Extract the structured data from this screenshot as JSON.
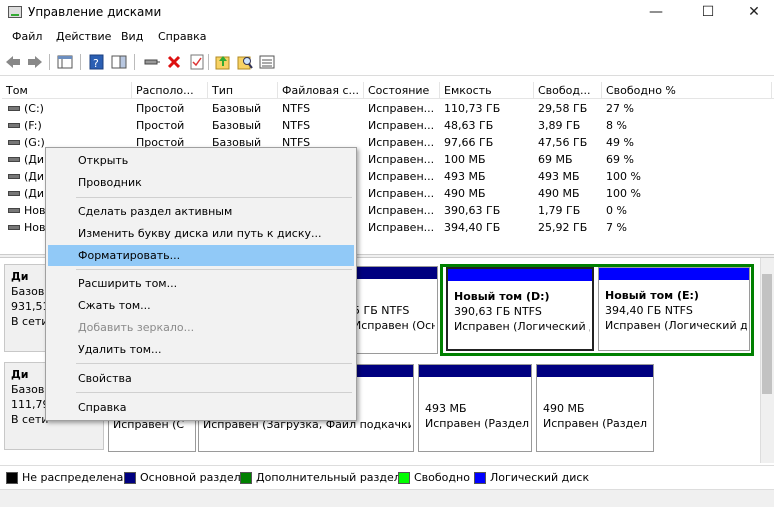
{
  "window": {
    "title": "Управление дисками",
    "minimize": "—",
    "maximize": "☐",
    "close": "✕"
  },
  "menu": [
    "Файл",
    "Действие",
    "Вид",
    "Справка"
  ],
  "table": {
    "columns": [
      "Том",
      "Располо...",
      "Тип",
      "Файловая с...",
      "Состояние",
      "Емкость",
      "Свобод...",
      "Свободно %"
    ],
    "rows": [
      [
        "(C:)",
        "Простой",
        "Базовый",
        "NTFS",
        "Исправен...",
        "110,73 ГБ",
        "29,58 ГБ",
        "27 %"
      ],
      [
        "(F:)",
        "Простой",
        "Базовый",
        "NTFS",
        "Исправен...",
        "48,63 ГБ",
        "3,89 ГБ",
        "8 %"
      ],
      [
        "(G:)",
        "Простой",
        "Базовый",
        "NTFS",
        "Исправен...",
        "97,66 ГБ",
        "47,56 ГБ",
        "49 %"
      ],
      [
        "(Ди",
        "",
        "",
        "",
        "Исправен...",
        "100 МБ",
        "69 МБ",
        "69 %"
      ],
      [
        "(Ди",
        "",
        "",
        "",
        "Исправен...",
        "493 МБ",
        "493 МБ",
        "100 %"
      ],
      [
        "(Ди",
        "",
        "",
        "",
        "Исправен...",
        "490 МБ",
        "490 МБ",
        "100 %"
      ],
      [
        "Нов",
        "",
        "",
        "",
        "Исправен...",
        "390,63 ГБ",
        "1,79 ГБ",
        "0 %"
      ],
      [
        "Нов",
        "",
        "",
        "",
        "Исправен...",
        "394,40 ГБ",
        "25,92 ГБ",
        "7 %"
      ]
    ]
  },
  "disk0": {
    "label_1": "Ди",
    "label_2": "Базов",
    "label_3": "931,51",
    "label_4": "В сети",
    "p1_l1": "5 ГБ NTFS",
    "p1_l2": "Исправен (Основной",
    "p2_l1": "Новый том  (D:)",
    "p2_l2": "390,63 ГБ NTFS",
    "p2_l3": "Исправен (Логический д",
    "p3_l1": "Новый том  (E:)",
    "p3_l2": "394,40 ГБ NTFS",
    "p3_l3": "Исправен (Логический д"
  },
  "disk1": {
    "label_1": "Ди",
    "label_2": "Базов",
    "label_3": "111,79",
    "label_4": "В сети",
    "p1_l1": "Исправен (С",
    "p2_l1": "Исправен (Загрузка, Файл подкачки, А",
    "p3_l1": "493 МБ",
    "p3_l2": "Исправен (Раздел",
    "p4_l1": "490 МБ",
    "p4_l2": "Исправен (Раздел"
  },
  "legend": [
    "Не распределена",
    "Основной раздел",
    "Дополнительный раздел",
    "Свободно",
    "Логический диск"
  ],
  "colors": {
    "unallocated": "#000000",
    "primary": "#000080",
    "extended": "#008000",
    "free": "#00ff00",
    "logical": "#0000ff",
    "highlight": "#91c9f7"
  },
  "context_menu": {
    "open": "Открыть",
    "explorer": "Проводник",
    "make_active": "Сделать раздел активным",
    "change_letter": "Изменить букву диска или путь к диску...",
    "format": "Форматировать...",
    "extend": "Расширить том...",
    "shrink": "Сжать том...",
    "add_mirror": "Добавить зеркало...",
    "delete": "Удалить том...",
    "properties": "Свойства",
    "help": "Справка"
  }
}
